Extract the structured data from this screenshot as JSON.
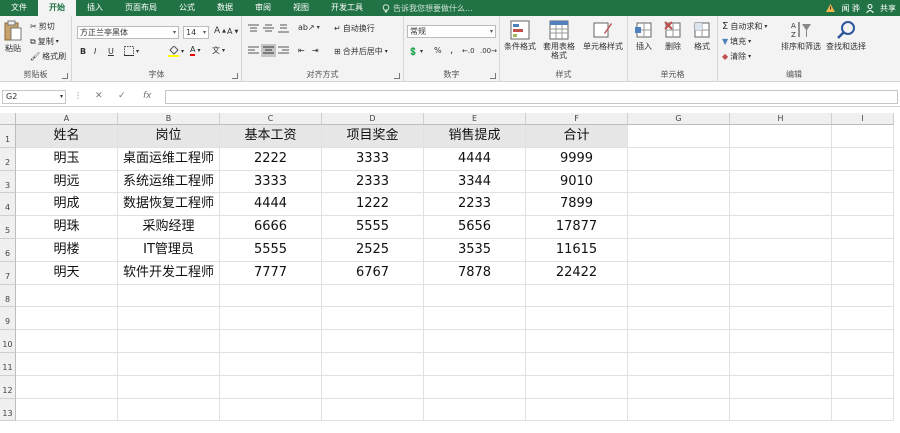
{
  "tabs": [
    "文件",
    "开始",
    "插入",
    "页面布局",
    "公式",
    "数据",
    "审阅",
    "视图",
    "开发工具"
  ],
  "active_tab": "开始",
  "tell_me": "告诉我您想要做什么...",
  "user": "闻 骅",
  "share": "共享",
  "ribbon": {
    "clipboard": {
      "paste": "粘贴",
      "cut": "剪切",
      "copy": "复制",
      "format_painter": "格式刷",
      "label": "剪贴板"
    },
    "font": {
      "font_name": "方正兰亭黑体",
      "font_size": "14",
      "bold": "B",
      "italic": "I",
      "underline": "U",
      "wen": "文",
      "label": "字体"
    },
    "alignment": {
      "wrap": "自动换行",
      "merge": "合并后居中",
      "label": "对齐方式"
    },
    "number": {
      "format": "常规",
      "percent": "%",
      "comma": ",",
      "label": "数字"
    },
    "styles": {
      "conditional": "条件格式",
      "table": "套用表格格式",
      "cell_styles": "单元格样式",
      "label": "样式"
    },
    "cells": {
      "insert": "插入",
      "delete": "删除",
      "format": "格式",
      "label": "单元格"
    },
    "editing": {
      "autosum": "自动求和",
      "fill": "填充",
      "clear": "清除",
      "sort": "排序和筛选",
      "find": "查找和选择",
      "label": "编辑"
    }
  },
  "name_box": "G2",
  "fx": "fx",
  "columns": [
    "A",
    "B",
    "C",
    "D",
    "E",
    "F",
    "G",
    "H",
    "I"
  ],
  "rows": [
    "1",
    "2",
    "3",
    "4",
    "5",
    "6",
    "7",
    "8",
    "9",
    "10",
    "11",
    "12",
    "13"
  ],
  "table": {
    "header": [
      "姓名",
      "岗位",
      "基本工资",
      "项目奖金",
      "销售提成",
      "合计"
    ],
    "body": [
      [
        "明玉",
        "桌面运维工程师",
        "2222",
        "3333",
        "4444",
        "9999"
      ],
      [
        "明远",
        "系统运维工程师",
        "3333",
        "2333",
        "3344",
        "9010"
      ],
      [
        "明成",
        "数据恢复工程师",
        "4444",
        "1222",
        "2233",
        "7899"
      ],
      [
        "明珠",
        "采购经理",
        "6666",
        "5555",
        "5656",
        "17877"
      ],
      [
        "明楼",
        "IT管理员",
        "5555",
        "2525",
        "3535",
        "11615"
      ],
      [
        "明天",
        "软件开发工程师",
        "7777",
        "6767",
        "7878",
        "22422"
      ]
    ]
  },
  "colors": {
    "accent": "#217346",
    "header_fill": "#e7e6e6"
  }
}
